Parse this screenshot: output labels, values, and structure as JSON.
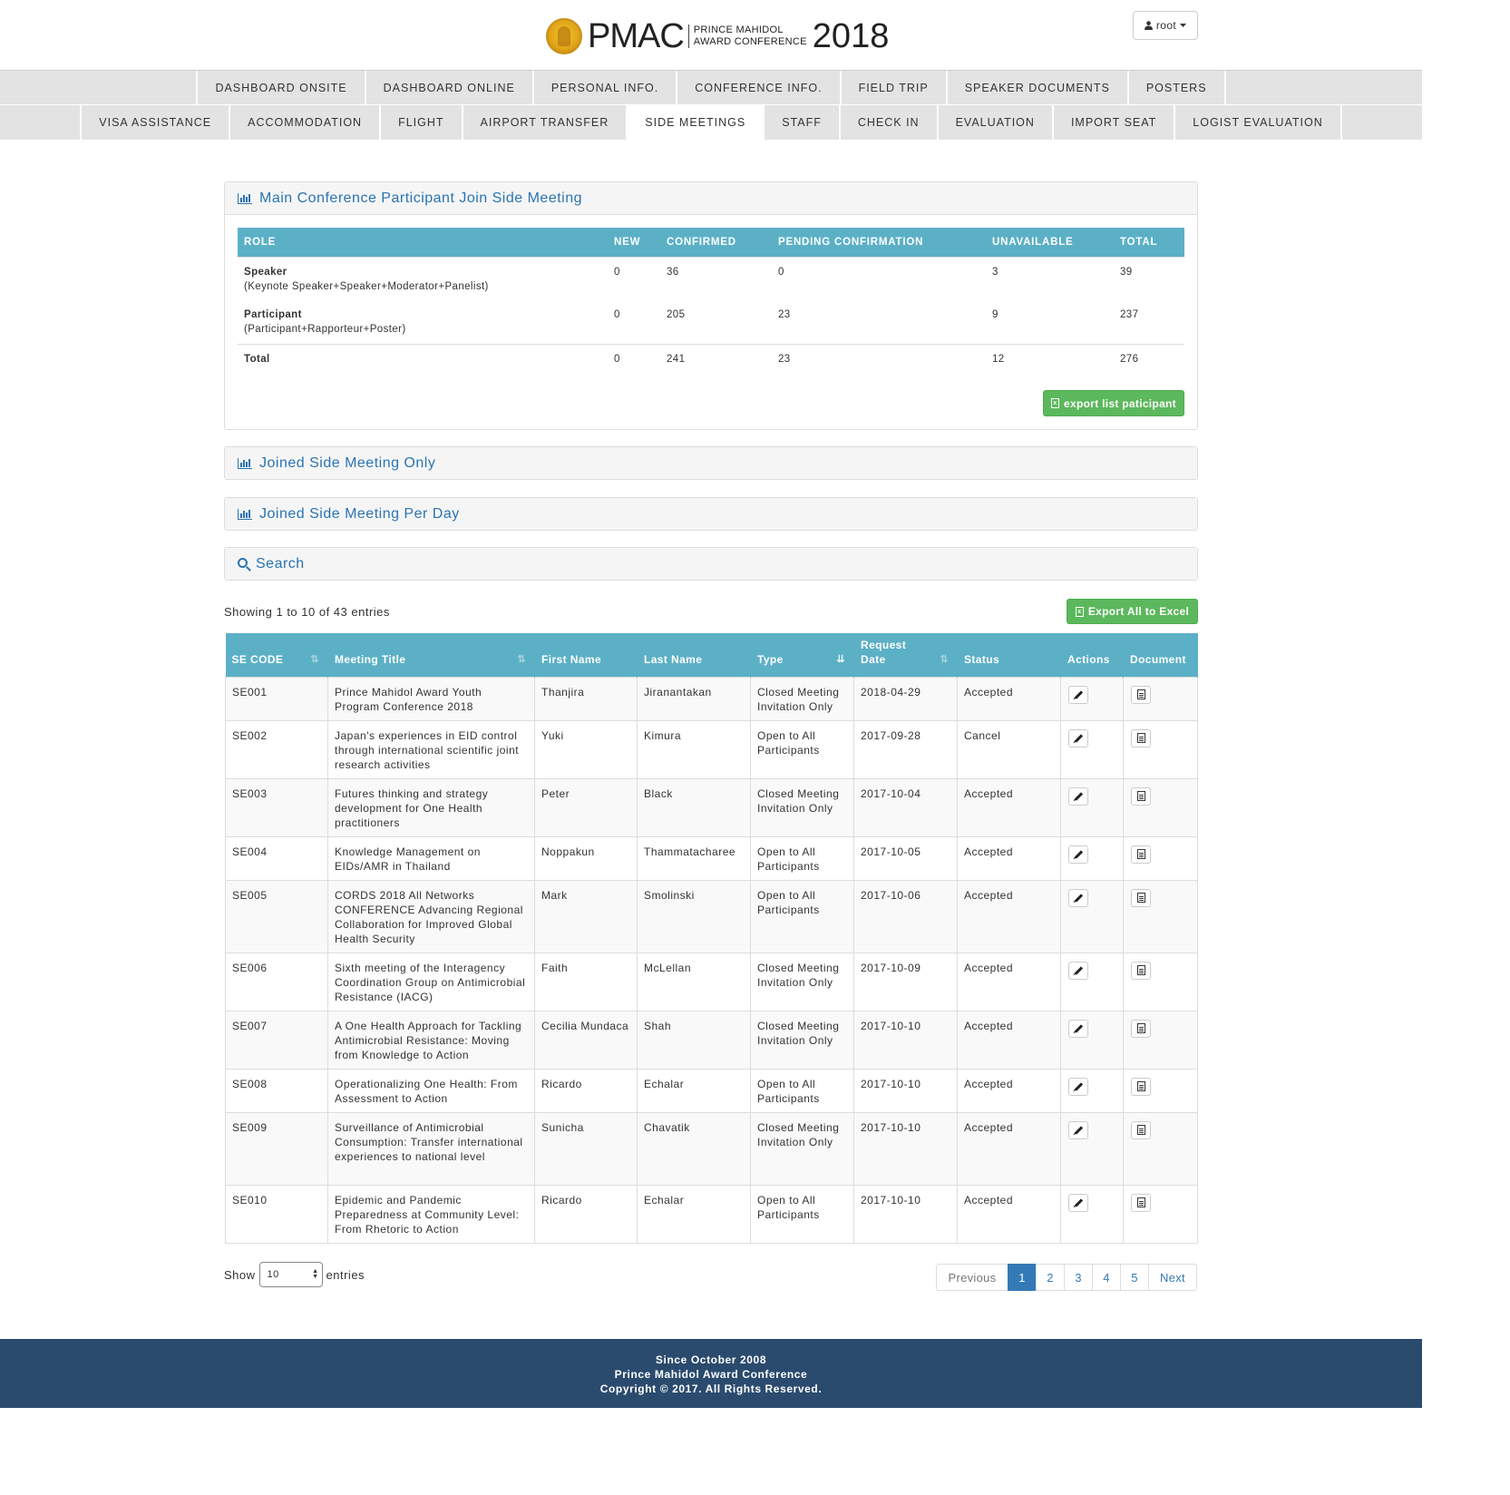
{
  "header": {
    "logo_text": "PMAC",
    "logo_sub_line1": "PRINCE  MAHIDOL",
    "logo_sub_line2": "AWARD CONFERENCE",
    "logo_year": "2018",
    "user_label": "root"
  },
  "nav_row1": [
    "DASHBOARD ONSITE",
    "DASHBOARD ONLINE",
    "PERSONAL INFO.",
    "CONFERENCE INFO.",
    "FIELD TRIP",
    "SPEAKER DOCUMENTS",
    "POSTERS"
  ],
  "nav_row2": [
    "VISA ASSISTANCE",
    "ACCOMMODATION",
    "FLIGHT",
    "AIRPORT TRANSFER",
    "SIDE MEETINGS",
    "STAFF",
    "CHECK IN",
    "EVALUATION",
    "IMPORT SEAT",
    "LOGIST EVALUATION"
  ],
  "nav_active": "SIDE MEETINGS",
  "summary_panel": {
    "title": "Main Conference Participant Join Side Meeting",
    "headers": [
      "ROLE",
      "NEW",
      "CONFIRMED",
      "PENDING CONFIRMATION",
      "UNAVAILABLE",
      "TOTAL"
    ],
    "rows": [
      {
        "role": "Speaker",
        "sub": "(Keynote Speaker+Speaker+Moderator+Panelist)",
        "new": "0",
        "confirmed": "36",
        "pending": "0",
        "unavailable": "3",
        "total": "39"
      },
      {
        "role": "Participant",
        "sub": "(Participant+Rapporteur+Poster)",
        "new": "0",
        "confirmed": "205",
        "pending": "23",
        "unavailable": "9",
        "total": "237"
      },
      {
        "role": "Total",
        "sub": "",
        "new": "0",
        "confirmed": "241",
        "pending": "23",
        "unavailable": "12",
        "total": "276"
      }
    ],
    "export_label": "export list paticipant"
  },
  "collapsed_panels": {
    "joined_only": "Joined Side Meeting Only",
    "per_day": "Joined Side Meeting Per Day",
    "search": "Search"
  },
  "table_info": "Showing 1 to 10 of 43 entries",
  "export_all_label": "Export All to Excel",
  "table": {
    "headers": {
      "code": "SE CODE",
      "title": "Meeting Title",
      "first": "First Name",
      "last": "Last Name",
      "type": "Type",
      "date_line1": "Request",
      "date_line2": "Date",
      "status": "Status",
      "actions": "Actions",
      "document": "Document"
    },
    "rows": [
      {
        "code": "SE001",
        "title": "Prince Mahidol Award Youth Program Conference 2018",
        "first": "Thanjira",
        "last": "Jiranantakan",
        "type": "Closed Meeting Invitation Only",
        "date": "2018-04-29",
        "status": "Accepted"
      },
      {
        "code": "SE002",
        "title": "Japan's experiences in EID control through international scientific joint research activities",
        "first": "Yuki",
        "last": "Kimura",
        "type": "Open to All Participants",
        "date": "2017-09-28",
        "status": "Cancel"
      },
      {
        "code": "SE003",
        "title": "Futures thinking and strategy development for One Health practitioners",
        "first": "Peter",
        "last": "Black",
        "type": "Closed Meeting Invitation Only",
        "date": "2017-10-04",
        "status": "Accepted"
      },
      {
        "code": "SE004",
        "title": "Knowledge Management on EIDs/AMR in Thailand",
        "first": "Noppakun",
        "last": "Thammatacharee",
        "type": "Open to All Participants",
        "date": "2017-10-05",
        "status": "Accepted"
      },
      {
        "code": "SE005",
        "title": "CORDS 2018 All Networks CONFERENCE Advancing Regional Collaboration for Improved Global Health Security",
        "first": "Mark",
        "last": "Smolinski",
        "type": "Open to All Participants",
        "date": "2017-10-06",
        "status": "Accepted"
      },
      {
        "code": "SE006",
        "title": "Sixth meeting of the Interagency Coordination Group on Antimicrobial Resistance (IACG)",
        "first": "Faith",
        "last": "McLellan",
        "type": "Closed Meeting Invitation Only",
        "date": "2017-10-09",
        "status": "Accepted"
      },
      {
        "code": "SE007",
        "title": "A One Health Approach for Tackling Antimicrobial Resistance: Moving from Knowledge to Action",
        "first": "Cecilia Mundaca",
        "last": "Shah",
        "type": "Closed Meeting Invitation Only",
        "date": "2017-10-10",
        "status": "Accepted"
      },
      {
        "code": "SE008",
        "title": "Operationalizing One Health: From Assessment to Action",
        "first": "Ricardo",
        "last": "Echalar",
        "type": "Open to All Participants",
        "date": "2017-10-10",
        "status": "Accepted"
      },
      {
        "code": "SE009",
        "title": "Surveillance of Antimicrobial Consumption: Transfer international experiences to national level",
        "first": "Sunicha",
        "last": "Chavatik",
        "type": "Closed Meeting Invitation Only",
        "date": "2017-10-10",
        "status": "Accepted"
      },
      {
        "code": "SE010",
        "title": "Epidemic and Pandemic Preparedness at Community Level: From Rhetoric to Action",
        "first": "Ricardo",
        "last": "Echalar",
        "type": "Open to All Participants",
        "date": "2017-10-10",
        "status": "Accepted"
      }
    ]
  },
  "length_menu": {
    "show": "Show",
    "value": "10",
    "entries": "entries"
  },
  "pagination": {
    "prev": "Previous",
    "pages": [
      "1",
      "2",
      "3",
      "4",
      "5"
    ],
    "active": "1",
    "next": "Next"
  },
  "footer": {
    "line1": "Since October 2008",
    "line2": "Prince Mahidol Award Conference",
    "line3": "Copyright © 2017. All Rights Reserved."
  },
  "colors": {
    "accent": "#5bb0c6",
    "link": "#2a74b3",
    "success": "#5cb85c",
    "footer_bg": "#2b4b6e",
    "nav_bg": "#e3e3e3"
  }
}
